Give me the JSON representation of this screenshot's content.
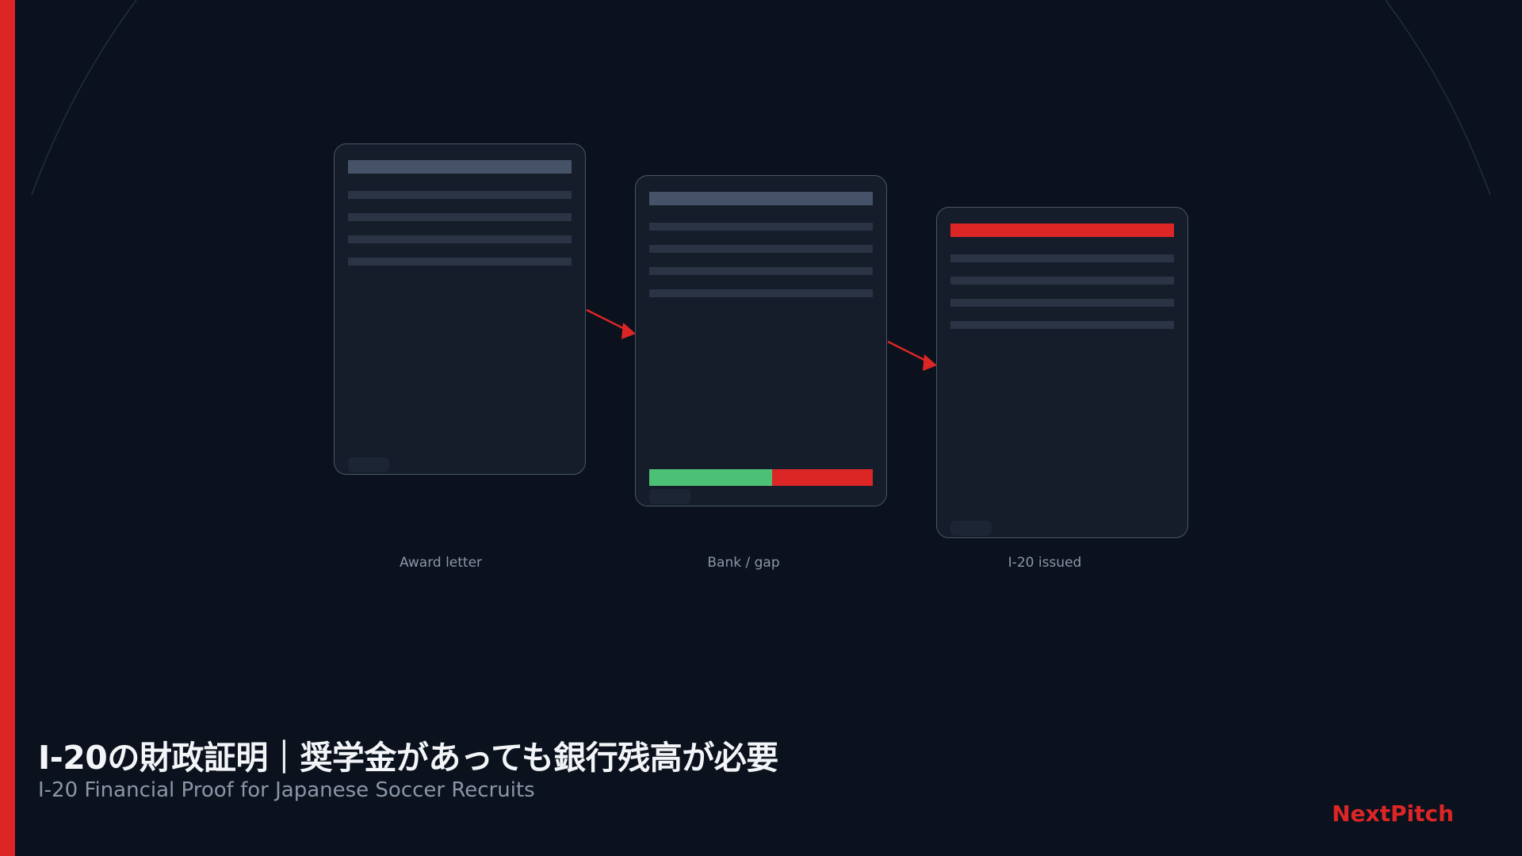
{
  "diagram": {
    "steps": [
      {
        "label": "Award letter",
        "header_color": "#465267"
      },
      {
        "label": "Bank / gap",
        "header_color": "#465267",
        "funded_color": "#4cc176",
        "gap_color": "#dc2626",
        "funded_fraction": 0.55
      },
      {
        "label": "I-20 issued",
        "header_color": "#dc2626"
      }
    ],
    "arrow_color": "#dc2626"
  },
  "title": "I-20の財政証明｜奨学金があっても銀行残高が必要",
  "subtitle": "I-20 Financial Proof for Japanese Soccer Recruits",
  "brand": "NextPitch",
  "colors": {
    "background": "#0b121d",
    "accent": "#dc2626",
    "card_fill": "#151d2a",
    "card_border": "#4a5566",
    "text_primary": "#f3f5f8",
    "text_secondary": "#8a96a8"
  }
}
